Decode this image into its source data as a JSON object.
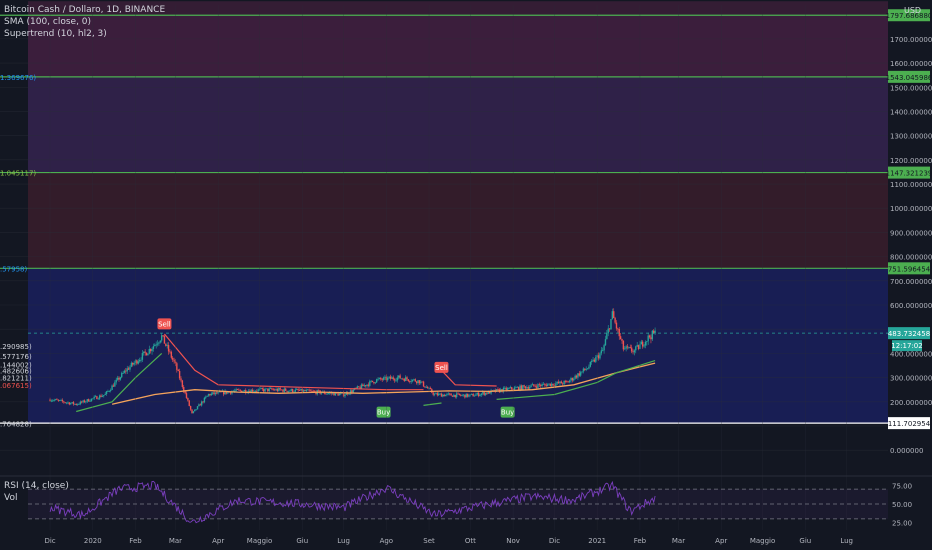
{
  "legend": {
    "symbol": "Bitcoin Cash / Dollaro, 1D, BINANCE",
    "sma": "SMA (100, close, 0)",
    "supertrend": "Supertrend (10, hl2, 3)",
    "rsi": "RSI (14, close)",
    "vol": "Vol"
  },
  "currency_label": "USD",
  "current_price_label": "483.732458",
  "countdown_label": "12:17:02",
  "price_axis_ticks": [
    "1700.000000",
    "1600.000000",
    "1500.000000",
    "1400.000000",
    "1300.000000",
    "1200.000000",
    "1100.000000",
    "1000.000000",
    "900.000000",
    "800.000000",
    "700.000000",
    "600.000000",
    "400.000000",
    "300.000000",
    "200.000000",
    "0.000000"
  ],
  "rsi_axis_ticks": [
    "75.00",
    "50.00",
    "25.00"
  ],
  "fib_right_labels": [
    "1797.686880",
    "1543.045986",
    "1147.321239",
    "751.596454",
    "111.702954"
  ],
  "fib_left_labels": [
    "1.369676)",
    "1.045117)",
    ".57958)",
    ".290985)",
    ".577176)",
    ".144002)",
    ".482606)",
    ".821211)",
    ".067615)",
    ".764828)"
  ],
  "signals": [
    "Sell",
    "Sell",
    "Buy",
    "Buy"
  ],
  "colors": {
    "background": "#131722",
    "fib_line": "#4caf50",
    "up_candle": "#26a69a",
    "down_candle": "#ef5350",
    "sma": "#f5a35b",
    "supertrend_up": "#4caf50",
    "supertrend_down": "#ef5350",
    "rsi": "#7b3fbf",
    "sell_badge": "#ef5350",
    "buy_badge": "#4caf50"
  },
  "chart_data": {
    "type": "candlestick",
    "x_ticks": [
      "Dic",
      "2020",
      "Feb",
      "Mar",
      "Apr",
      "Maggio",
      "Giu",
      "Lug",
      "Ago",
      "Set",
      "Ott",
      "Nov",
      "Dic",
      "2021",
      "Feb",
      "Mar",
      "Apr",
      "Maggio",
      "Giu",
      "Lug"
    ],
    "fib_levels": [
      1797.68688,
      1543.045986,
      1147.321239,
      751.596454,
      111.702954
    ],
    "ylim": [
      -20,
      1840
    ],
    "current_price": 483.732458,
    "close_path": [
      [
        "2019-12-01",
        210
      ],
      [
        "2019-12-20",
        190
      ],
      [
        "2020-01-10",
        230
      ],
      [
        "2020-01-25",
        330
      ],
      [
        "2020-02-12",
        420
      ],
      [
        "2020-02-20",
        470
      ],
      [
        "2020-03-01",
        350
      ],
      [
        "2020-03-13",
        150
      ],
      [
        "2020-03-25",
        230
      ],
      [
        "2020-04-15",
        245
      ],
      [
        "2020-05-10",
        250
      ],
      [
        "2020-06-01",
        245
      ],
      [
        "2020-07-01",
        230
      ],
      [
        "2020-07-25",
        290
      ],
      [
        "2020-08-10",
        300
      ],
      [
        "2020-08-25",
        285
      ],
      [
        "2020-09-05",
        230
      ],
      [
        "2020-10-01",
        225
      ],
      [
        "2020-10-25",
        250
      ],
      [
        "2020-11-15",
        265
      ],
      [
        "2020-12-10",
        280
      ],
      [
        "2020-12-25",
        340
      ],
      [
        "2021-01-05",
        410
      ],
      [
        "2021-01-12",
        560
      ],
      [
        "2021-01-20",
        420
      ],
      [
        "2021-01-28",
        410
      ],
      [
        "2021-02-08",
        470
      ],
      [
        "2021-02-12",
        484
      ]
    ],
    "sma_100": [
      [
        "2020-01-15",
        190
      ],
      [
        "2020-02-15",
        230
      ],
      [
        "2020-03-15",
        250
      ],
      [
        "2020-04-15",
        240
      ],
      [
        "2020-05-15",
        235
      ],
      [
        "2020-06-15",
        240
      ],
      [
        "2020-07-15",
        235
      ],
      [
        "2020-08-15",
        240
      ],
      [
        "2020-09-15",
        245
      ],
      [
        "2020-10-15",
        243
      ],
      [
        "2020-11-15",
        250
      ],
      [
        "2020-12-15",
        270
      ],
      [
        "2021-01-15",
        320
      ],
      [
        "2021-02-12",
        360
      ]
    ],
    "supertrend": [
      {
        "direction": "up",
        "points": [
          [
            "2019-12-20",
            160
          ],
          [
            "2020-01-15",
            200
          ],
          [
            "2020-02-01",
            300
          ],
          [
            "2020-02-20",
            400
          ]
        ]
      },
      {
        "direction": "down",
        "points": [
          [
            "2020-02-22",
            480
          ],
          [
            "2020-03-15",
            330
          ],
          [
            "2020-04-01",
            270
          ],
          [
            "2020-06-01",
            260
          ],
          [
            "2020-08-01",
            250
          ],
          [
            "2020-08-28",
            250
          ]
        ]
      },
      {
        "direction": "up",
        "points": [
          [
            "2020-08-28",
            185
          ],
          [
            "2020-09-10",
            195
          ]
        ]
      },
      {
        "direction": "down",
        "points": [
          [
            "2020-09-10",
            330
          ],
          [
            "2020-09-20",
            270
          ],
          [
            "2020-10-20",
            265
          ]
        ]
      },
      {
        "direction": "up",
        "points": [
          [
            "2020-10-20",
            210
          ],
          [
            "2020-12-01",
            230
          ],
          [
            "2021-01-01",
            280
          ],
          [
            "2021-01-15",
            320
          ],
          [
            "2021-02-12",
            370
          ]
        ]
      }
    ],
    "signal_points": [
      {
        "label": "Sell",
        "date": "2020-02-22",
        "price": 520
      },
      {
        "label": "Sell",
        "date": "2020-09-10",
        "price": 340
      },
      {
        "label": "Buy",
        "date": "2020-07-30",
        "price": 155
      },
      {
        "label": "Buy",
        "date": "2020-10-28",
        "price": 155
      }
    ],
    "rsi": {
      "ylim": [
        15,
        85
      ],
      "guides": [
        70,
        50,
        30
      ],
      "path": [
        [
          "2019-12-01",
          45
        ],
        [
          "2019-12-25",
          35
        ],
        [
          "2020-01-20",
          70
        ],
        [
          "2020-02-15",
          75
        ],
        [
          "2020-03-13",
          25
        ],
        [
          "2020-04-15",
          55
        ],
        [
          "2020-06-01",
          50
        ],
        [
          "2020-07-01",
          45
        ],
        [
          "2020-08-01",
          72
        ],
        [
          "2020-09-05",
          35
        ],
        [
          "2020-10-15",
          50
        ],
        [
          "2020-11-15",
          60
        ],
        [
          "2020-12-15",
          55
        ],
        [
          "2021-01-12",
          75
        ],
        [
          "2021-01-25",
          40
        ],
        [
          "2021-02-12",
          58
        ]
      ]
    }
  }
}
